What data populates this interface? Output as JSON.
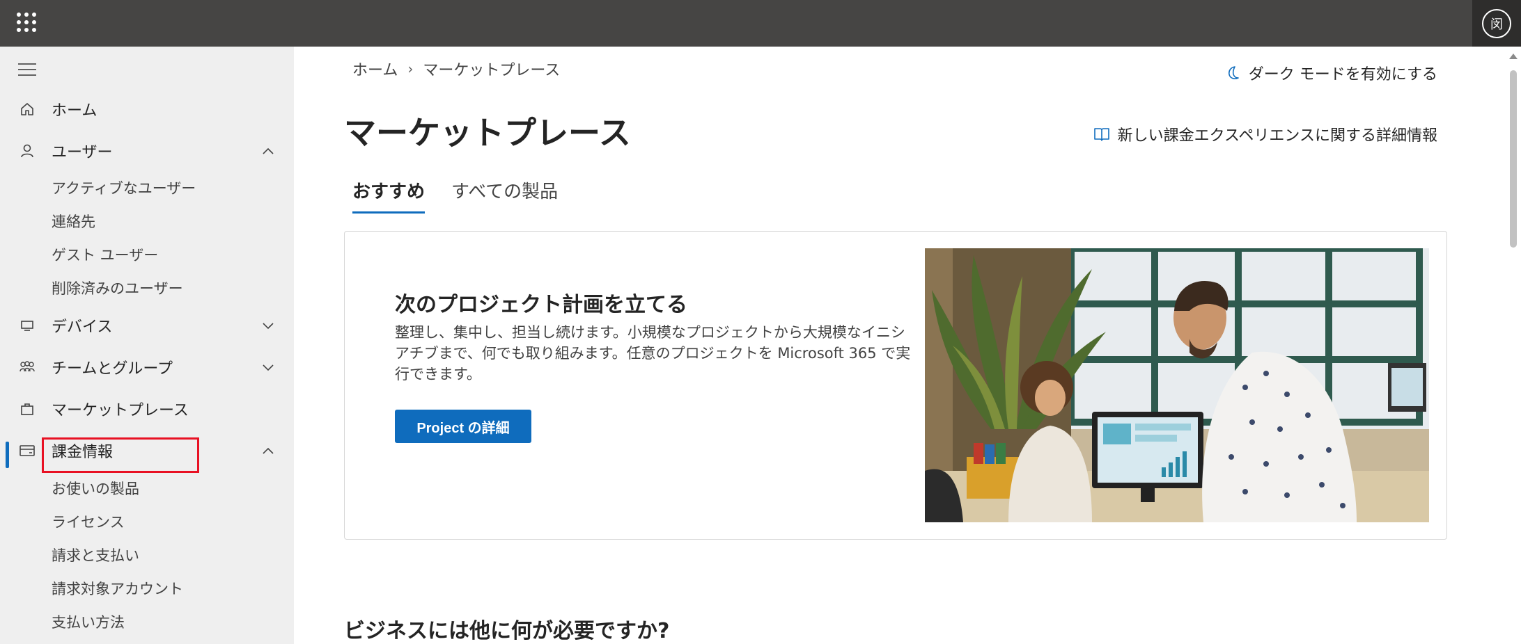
{
  "topbar": {
    "avatar_text": "闵"
  },
  "sidebar": {
    "items": [
      {
        "label": "ホーム",
        "icon": "home-icon"
      },
      {
        "label": "ユーザー",
        "icon": "user-icon",
        "expanded": true,
        "children": [
          "アクティブなユーザー",
          "連絡先",
          "ゲスト ユーザー",
          "削除済みのユーザー"
        ]
      },
      {
        "label": "デバイス",
        "icon": "device-icon",
        "expanded": false
      },
      {
        "label": "チームとグループ",
        "icon": "teams-icon",
        "expanded": false
      },
      {
        "label": "マーケットプレース",
        "icon": "shopping-bag-icon",
        "selected": true
      },
      {
        "label": "課金情報",
        "icon": "billing-card-icon",
        "expanded": true,
        "children": [
          "お使いの製品",
          "ライセンス",
          "請求と支払い",
          "請求対象アカウント",
          "支払い方法"
        ]
      }
    ]
  },
  "breadcrumb": {
    "home": "ホーム",
    "current": "マーケットプレース"
  },
  "header": {
    "dark_mode_label": "ダーク モードを有効にする",
    "title": "マーケットプレース",
    "learn_more_label": "新しい課金エクスペリエンスに関する詳細情報"
  },
  "tabs": [
    {
      "label": "おすすめ",
      "active": true
    },
    {
      "label": "すべての製品",
      "active": false
    }
  ],
  "promo_card": {
    "title": "次のプロジェクト計画を立てる",
    "description": "整理し、集中し、担当し続けます。小規模なプロジェクトから大規模なイニシアチブまで、何でも取り組みます。任意のプロジェクトを Microsoft 365 で実行できます。",
    "button_label": "Project の詳細"
  },
  "section": {
    "title": "ビジネスには他に何が必要ですか?"
  },
  "colors": {
    "accent": "#0f6cbd",
    "topbar": "#464544",
    "sidebar": "#efefef",
    "highlight": "#e81123"
  }
}
